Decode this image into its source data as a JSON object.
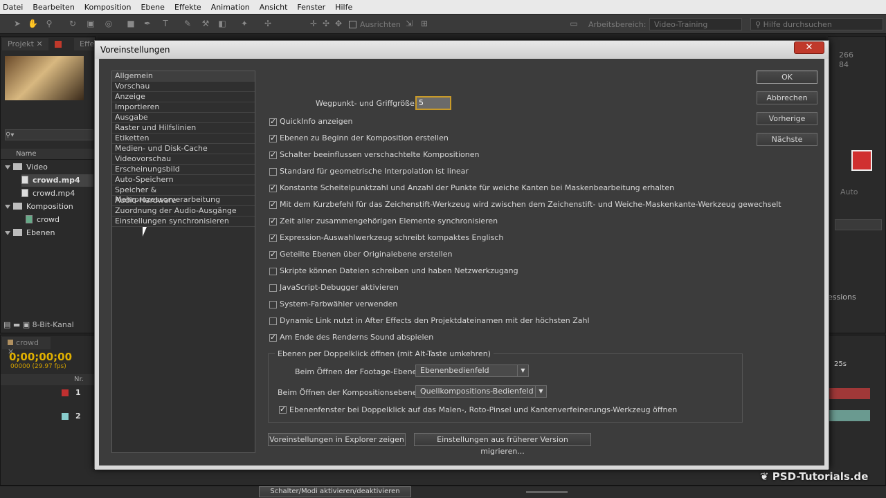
{
  "menu": [
    "Datei",
    "Bearbeiten",
    "Komposition",
    "Ebene",
    "Effekte",
    "Animation",
    "Ansicht",
    "Fenster",
    "Hilfe"
  ],
  "toolbar": {
    "align_label": "Ausrichten",
    "workspace_label": "Arbeitsbereich:",
    "workspace_value": "Video-Training",
    "help_placeholder": "Hilfe durchsuchen"
  },
  "project": {
    "tab": "Projekt",
    "tab2": "Effe",
    "column_name": "Name",
    "items": [
      {
        "label": "Video",
        "type": "folder"
      },
      {
        "label": "crowd.mp4",
        "type": "file",
        "selected": true
      },
      {
        "label": "crowd.mp4",
        "type": "file"
      },
      {
        "label": "Komposition",
        "type": "folder"
      },
      {
        "label": "crowd",
        "type": "comp"
      },
      {
        "label": "Ebenen",
        "type": "folder"
      }
    ],
    "bitdepth": "8-Bit-Kanal"
  },
  "right_info": {
    "v1": "266",
    "v2": "84",
    "auto": "Auto",
    "essions": "essions",
    "t25": "25s"
  },
  "timeline": {
    "tab": "crowd",
    "timecode": "0;00;00;00",
    "frames": "00000 (29.97 fps)",
    "col_nr": "Nr.",
    "rows": [
      {
        "nr": "1"
      },
      {
        "nr": "2"
      }
    ]
  },
  "dialog": {
    "title": "Voreinstellungen",
    "close": "✕",
    "categories": [
      "Allgemein",
      "Vorschau",
      "Anzeige",
      "Importieren",
      "Ausgabe",
      "Raster und Hilfslinien",
      "Etiketten",
      "Medien- und Disk-Cache",
      "Videovorschau",
      "Erscheinungsbild",
      "Auto-Speichern",
      "Speicher & Mehrprozessorverarbeitung",
      "Audio-Hardware",
      "Zuordnung der Audio-Ausgänge",
      "Einstellungen synchronisieren"
    ],
    "selected_category": "Allgemein",
    "handle_size_label": "Wegpunkt- und Griffgröße:",
    "handle_size_value": "5",
    "options": [
      {
        "label": "QuickInfo anzeigen",
        "checked": true
      },
      {
        "label": "Ebenen zu Beginn der Komposition erstellen",
        "checked": true
      },
      {
        "label": "Schalter beeinflussen verschachtelte Kompositionen",
        "checked": true
      },
      {
        "label": "Standard für geometrische Interpolation ist linear",
        "checked": false
      },
      {
        "label": "Konstante Scheitelpunktzahl und Anzahl der Punkte für weiche Kanten bei Maskenbearbeitung erhalten",
        "checked": true
      },
      {
        "label": "Mit dem Kurzbefehl für das Zeichenstift-Werkzeug wird zwischen dem Zeichenstift- und Weiche-Maskenkante-Werkzeug gewechselt",
        "checked": true
      },
      {
        "label": "Zeit aller zusammengehörigen Elemente synchronisieren",
        "checked": true
      },
      {
        "label": "Expression-Auswahlwerkzeug schreibt kompaktes Englisch",
        "checked": true
      },
      {
        "label": "Geteilte Ebenen über Originalebene erstellen",
        "checked": true
      },
      {
        "label": "Skripte können Dateien schreiben und haben Netzwerkzugang",
        "checked": false
      },
      {
        "label": "JavaScript-Debugger aktivieren",
        "checked": false
      },
      {
        "label": "System-Farbwähler verwenden",
        "checked": false
      },
      {
        "label": "Dynamic Link nutzt in After Effects den Projektdateinamen mit der höchsten Zahl",
        "checked": false
      },
      {
        "label": "Am Ende des Renderns Sound abspielen",
        "checked": true
      }
    ],
    "group": {
      "title": "Ebenen per Doppelklick öffnen (mit Alt-Taste umkehren)",
      "footage_label": "Beim Öffnen der Footage-Ebene:",
      "footage_value": "Ebenenbedienfeld",
      "comp_label": "Beim Öffnen der Kompositionsebene:",
      "comp_value": "Quellkompositions-Bedienfeld",
      "paint_label": "Ebenenfenster bei Doppelklick auf das Malen-, Roto-Pinsel und Kantenverfeinerungs-Werkzeug öffnen",
      "paint_checked": true
    },
    "btn_show_explorer": "Voreinstellungen in Explorer zeigen",
    "btn_migrate": "Einstellungen aus früherer Version migrieren...",
    "buttons": {
      "ok": "OK",
      "cancel": "Abbrechen",
      "prev": "Vorherige",
      "next": "Nächste"
    }
  },
  "status": {
    "toggle": "Schalter/Modi aktivieren/deaktivieren"
  },
  "watermark": "PSD-Tutorials.de"
}
